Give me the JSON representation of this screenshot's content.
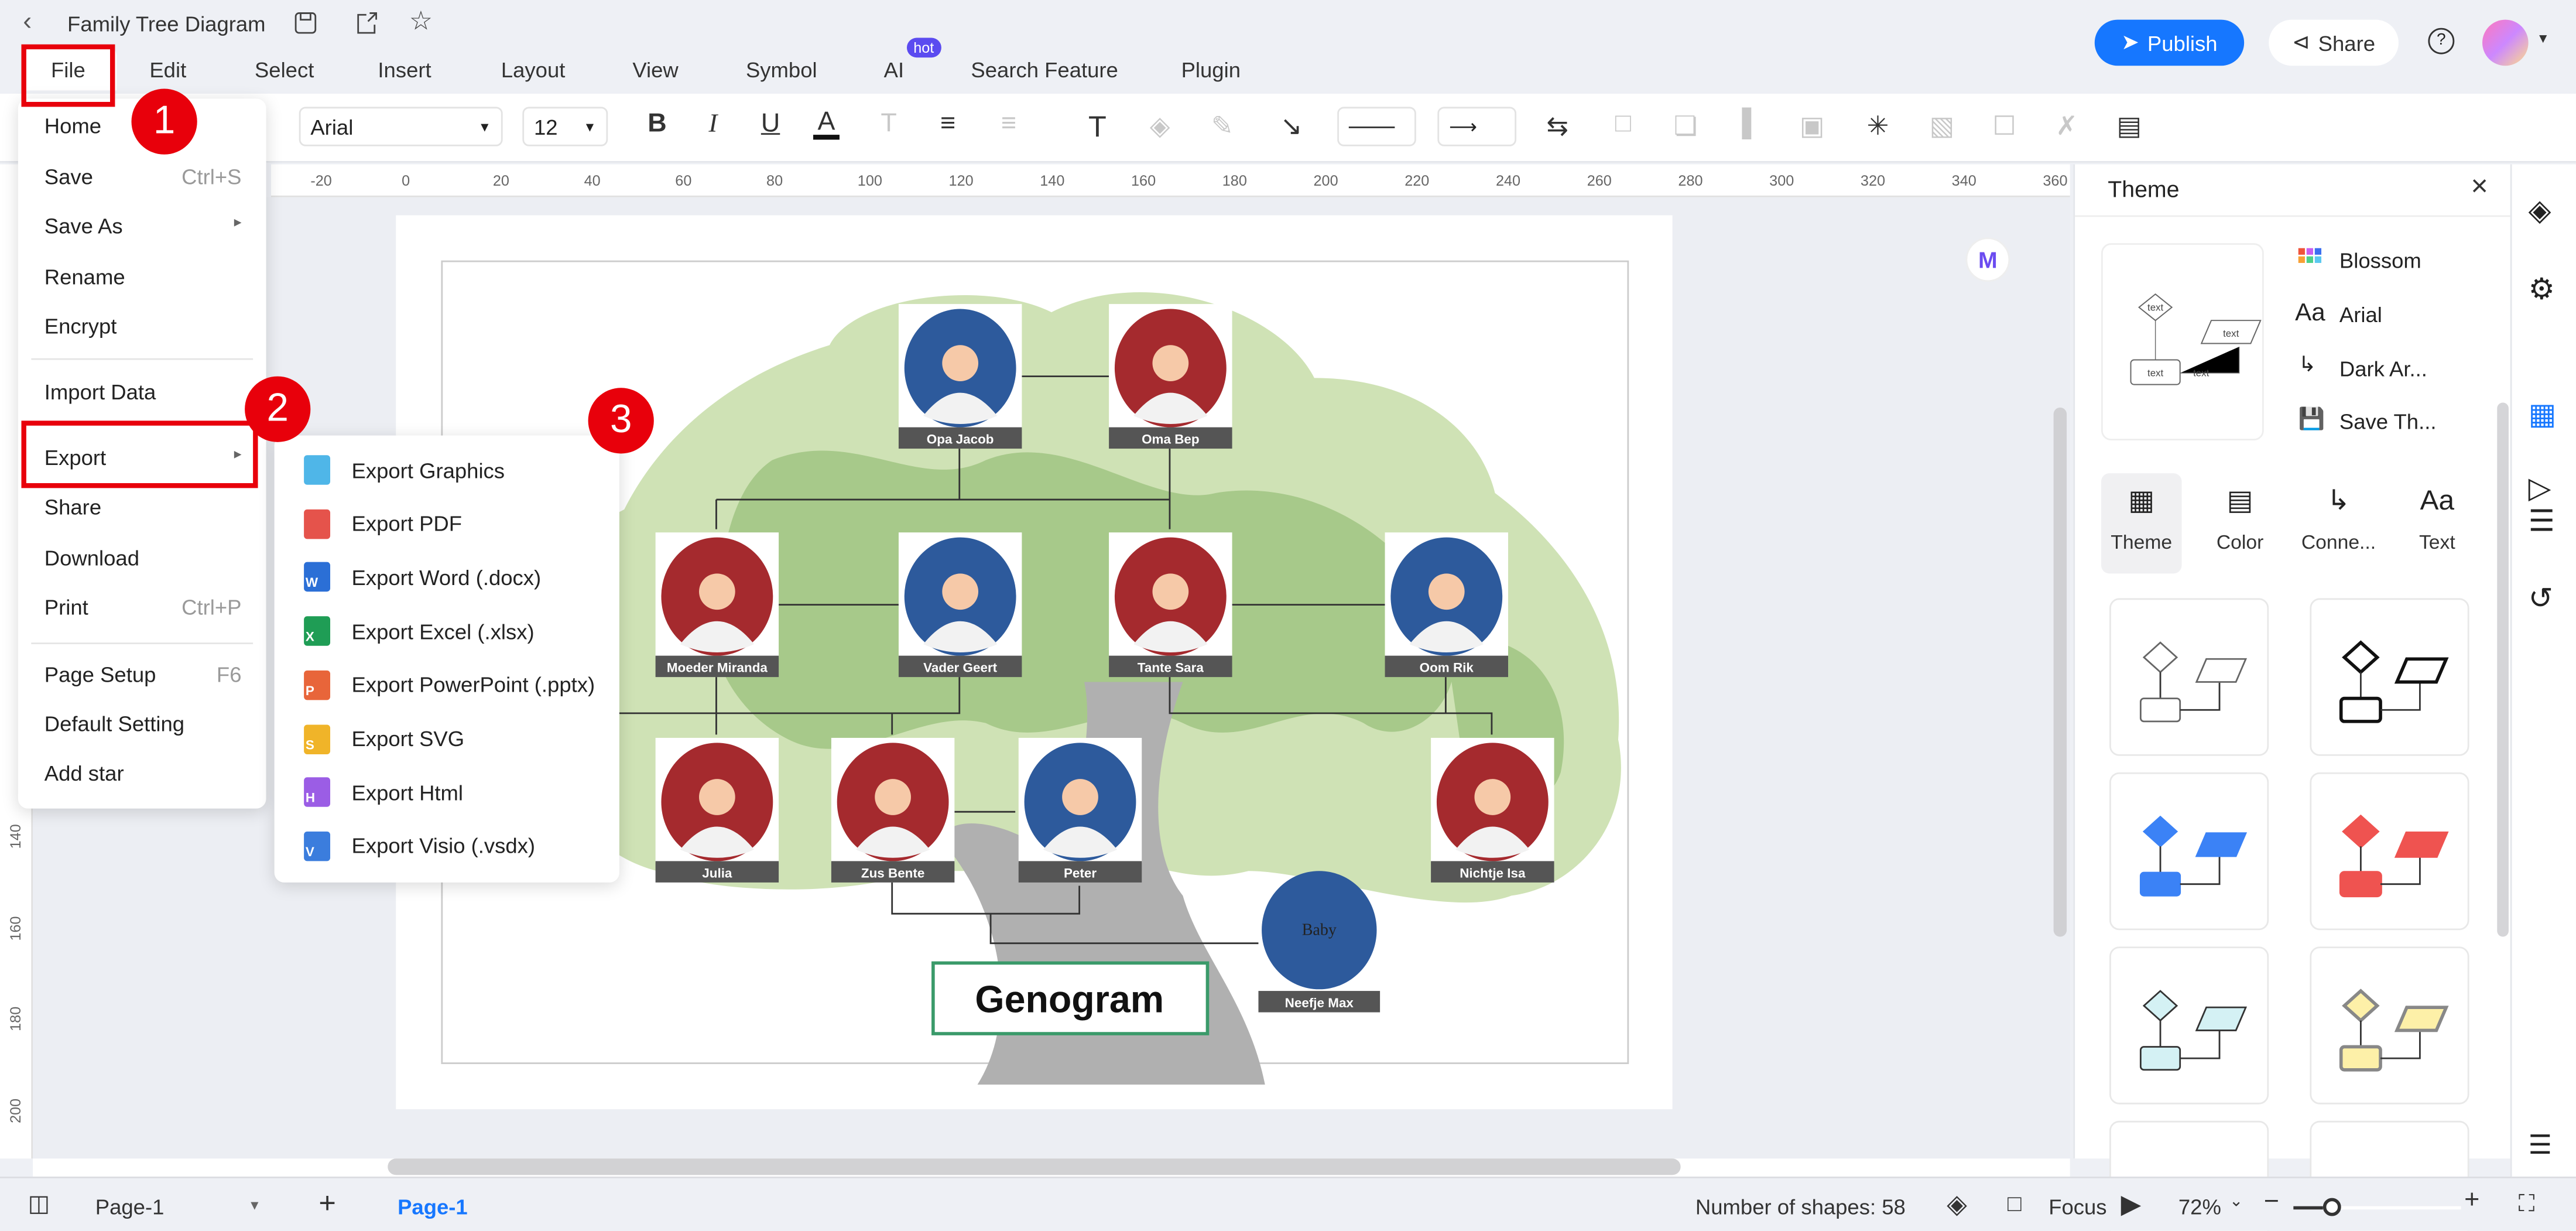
{
  "app": {
    "title": "Family Tree Diagram",
    "publish": "Publish",
    "share": "Share",
    "brand_color": "#1677ff"
  },
  "menubar": {
    "items": [
      "File",
      "Edit",
      "Select",
      "Insert",
      "Layout",
      "View",
      "Symbol",
      "AI",
      "Search Feature",
      "Plugin"
    ],
    "hot_badge": "hot"
  },
  "toolbar": {
    "font": "Arial",
    "size": "12"
  },
  "ruler": {
    "h": [
      "-20",
      "0",
      "20",
      "40",
      "60",
      "80",
      "100",
      "120",
      "140",
      "160",
      "180",
      "200",
      "220",
      "240",
      "260",
      "280",
      "300",
      "320",
      "340",
      "360"
    ],
    "v": [
      "140",
      "160",
      "180",
      "200"
    ]
  },
  "file_menu": {
    "items": [
      {
        "label": "Home",
        "shortcut": ""
      },
      {
        "label": "Save",
        "shortcut": "Ctrl+S"
      },
      {
        "label": "Save As",
        "shortcut": ""
      },
      {
        "label": "Rename",
        "shortcut": ""
      },
      {
        "label": "Encrypt",
        "shortcut": ""
      },
      {
        "label": "Import Data",
        "shortcut": ""
      },
      {
        "label": "Export",
        "shortcut": ""
      },
      {
        "label": "Share",
        "shortcut": ""
      },
      {
        "label": "Download",
        "shortcut": ""
      },
      {
        "label": "Print",
        "shortcut": "Ctrl+P"
      },
      {
        "label": "Page Setup",
        "shortcut": "F6"
      },
      {
        "label": "Default Setting",
        "shortcut": ""
      },
      {
        "label": "Add star",
        "shortcut": ""
      }
    ]
  },
  "export_menu": {
    "items": [
      {
        "label": "Export Graphics",
        "icon": "image-file-icon",
        "letter": "",
        "color": "#4fb6e8"
      },
      {
        "label": "Export PDF",
        "icon": "pdf-file-icon",
        "letter": "",
        "color": "#e5534b"
      },
      {
        "label": "Export Word (.docx)",
        "icon": "word-file-icon",
        "letter": "W",
        "color": "#2b6fd6"
      },
      {
        "label": "Export Excel (.xlsx)",
        "icon": "excel-file-icon",
        "letter": "X",
        "color": "#1f9d55"
      },
      {
        "label": "Export PowerPoint (.pptx)",
        "icon": "powerpoint-file-icon",
        "letter": "P",
        "color": "#e8653a"
      },
      {
        "label": "Export SVG",
        "icon": "svg-file-icon",
        "letter": "S",
        "color": "#f0b429"
      },
      {
        "label": "Export Html",
        "icon": "html-file-icon",
        "letter": "H",
        "color": "#9b5de5"
      },
      {
        "label": "Export Visio (.vsdx)",
        "icon": "visio-file-icon",
        "letter": "V",
        "color": "#3b7ddd"
      }
    ]
  },
  "annotations": [
    "1",
    "2",
    "3"
  ],
  "diagram": {
    "title": "Genogram",
    "people": [
      {
        "name": "Opa Jacob",
        "color": "#2d5a9c"
      },
      {
        "name": "Oma Bep",
        "color": "#a52a2e"
      },
      {
        "name": "Moeder Miranda",
        "color": "#a52a2e"
      },
      {
        "name": "Vader Geert",
        "color": "#2d5a9c"
      },
      {
        "name": "Tante Sara",
        "color": "#a52a2e"
      },
      {
        "name": "Oom Rik",
        "color": "#2d5a9c"
      },
      {
        "name": "Julia",
        "color": "#a52a2e"
      },
      {
        "name": "Zus Bente",
        "color": "#a52a2e"
      },
      {
        "name": "Peter",
        "color": "#2d5a9c"
      },
      {
        "name": "Nichtje Isa",
        "color": "#a52a2e"
      }
    ],
    "baby": {
      "text": "Baby",
      "name": "Neefje Max",
      "color": "#2d5a9c"
    }
  },
  "theme_panel": {
    "title": "Theme",
    "current": {
      "preview_text": "text",
      "color_scheme": "Blossom",
      "font": "Arial",
      "connector": "Dark Ar...",
      "save": "Save Th..."
    },
    "tabs": [
      "Theme",
      "Color",
      "Conne...",
      "Text"
    ],
    "active_tab": "Theme",
    "cards": [
      {
        "fill": "#ffffff",
        "stroke": "#666666"
      },
      {
        "fill": "#ffffff",
        "stroke": "#111111"
      },
      {
        "fill": "#3b82f6",
        "stroke": "#3b82f6"
      },
      {
        "fill": "#ef5350",
        "stroke": "#ef5350"
      },
      {
        "fill": "#d4f1f4",
        "stroke": "#333333"
      },
      {
        "fill": "#fdf0a8",
        "stroke": "#888888"
      }
    ]
  },
  "status": {
    "page_select": "Page-1",
    "active_page": "Page-1",
    "shapes": "Number of shapes: 58",
    "focus": "Focus",
    "zoom": "72%",
    "zoom_level": 0.72
  }
}
